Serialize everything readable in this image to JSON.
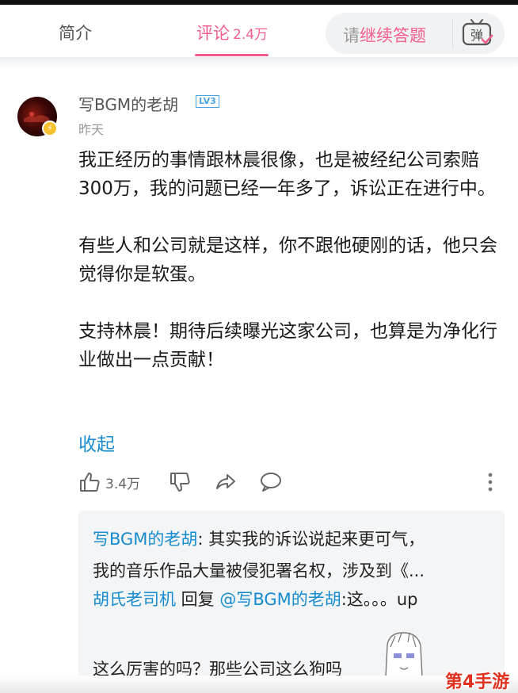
{
  "tabs": {
    "intro": "简介",
    "comments_label": "评论",
    "comments_count": "2.4万",
    "danmaku_prefix": "请",
    "danmaku_highlight": "继续答题",
    "danmaku_icon_glyph": "弹"
  },
  "comment": {
    "username": "写BGM的老胡",
    "level": "LV3",
    "time": "昨天",
    "paragraphs": [
      "我正经历的事情跟林晨很像，也是被经纪公司索赔300万，我的问题已经一年多了，诉讼正在进行中。",
      "有些人和公司就是这样，你不跟他硬刚的话，他只会觉得你是软蛋。",
      "支持林晨！期待后续曝光这家公司，也算是为净化行业做出一点贡献！"
    ],
    "collapse_label": "收起",
    "like_count": "3.4万"
  },
  "replies": {
    "r1_user": "写BGM的老胡",
    "r1_text": ": 其实我的诉讼说起来更可气，",
    "r1_text2": "我的音乐作品大量被侵犯署名权，涉及到《...",
    "r2_user": "胡氏老司机",
    "r2_mid": " 回复 ",
    "r2_mention": "@写BGM的老胡",
    "r2_text": ":这。。。up",
    "r3_text": "这么厉害的吗？那些公司这么狗吗"
  },
  "watermark": "第4手游",
  "colors": {
    "accent_pink": "#f25d8e",
    "link_blue": "#178bcf",
    "badge_yellow": "#f6c12d",
    "watermark_red": "#e0301e"
  }
}
